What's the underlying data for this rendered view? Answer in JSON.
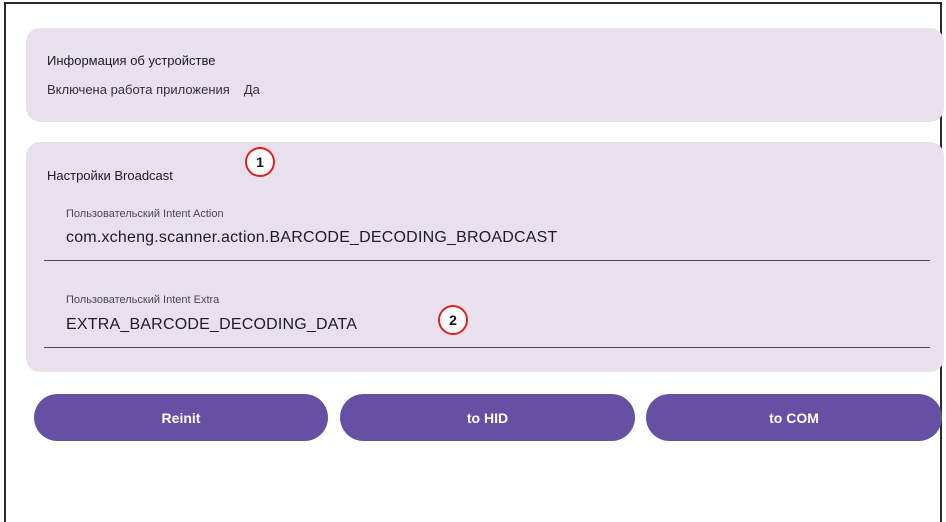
{
  "device_info": {
    "title": "Информация об устройстве",
    "row_label": "Включена работа приложения",
    "row_value": "Да"
  },
  "broadcast": {
    "title": "Настройки Broadcast",
    "action_field": {
      "label": "Пользовательский Intent Action",
      "value": "com.xcheng.scanner.action.BARCODE_DECODING_BROADCAST"
    },
    "extra_field": {
      "label": "Пользовательский Intent Extra",
      "value": "EXTRA_BARCODE_DECODING_DATA"
    }
  },
  "markers": [
    "1",
    "2"
  ],
  "buttons": {
    "reinit": "Reinit",
    "to_hid": "to HID",
    "to_com": "to COM"
  },
  "colors": {
    "card_bg": "#e8e1ed",
    "button_bg": "#6750a4",
    "marker_border": "#e02020"
  }
}
